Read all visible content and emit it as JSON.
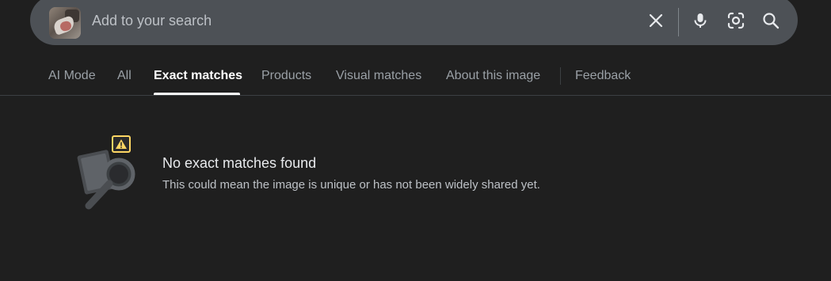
{
  "search": {
    "placeholder": "Add to your search",
    "query_image": "uploaded-image-thumbnail"
  },
  "toolbar": {
    "icons": [
      "close-icon",
      "microphone-icon",
      "google-lens-icon",
      "search-icon"
    ]
  },
  "tabs": [
    {
      "label": "AI Mode",
      "active": false
    },
    {
      "label": "All",
      "active": false
    },
    {
      "label": "Exact matches",
      "active": true
    },
    {
      "label": "Products",
      "active": false
    },
    {
      "label": "Visual matches",
      "active": false
    },
    {
      "label": "About this image",
      "active": false
    },
    {
      "label": "Feedback",
      "active": false
    }
  ],
  "result": {
    "title": "No exact matches found",
    "message": "This could mean the image is unique or has not been widely shared yet.",
    "illustration": "no-results-magnifier-illustration"
  },
  "colors": {
    "background": "#1f1f1f",
    "search_bar": "#4d5156",
    "tab_active": "#ffffff",
    "tab_inactive": "#9aa0a6",
    "warning_accent": "#fdd663"
  }
}
